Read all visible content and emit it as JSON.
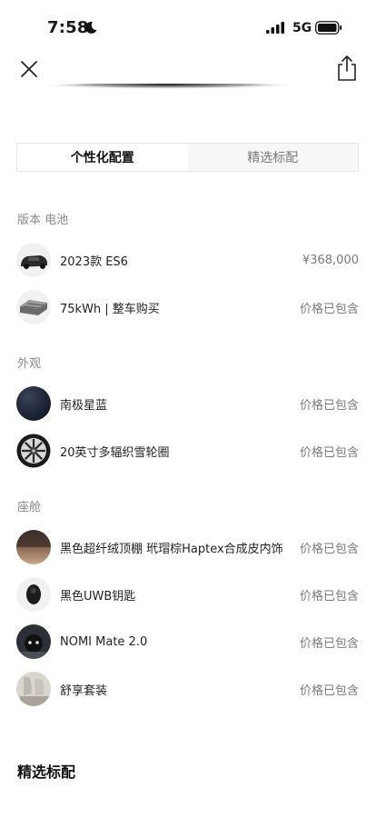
{
  "status_bar": {
    "time": "7:58",
    "network": "5G"
  },
  "tabs": [
    {
      "label": "个性化配置",
      "active": true
    },
    {
      "label": "精选标配",
      "active": false
    }
  ],
  "sections": [
    {
      "title": "版本 电池",
      "items": [
        {
          "label": "2023款 ES6",
          "price": "¥368,000",
          "icon": "car-thumbnail"
        },
        {
          "label": "75kWh | 整车购买",
          "price": "价格已包含",
          "icon": "battery-pack-thumbnail"
        }
      ]
    },
    {
      "title": "外观",
      "items": [
        {
          "label": "南极星蓝",
          "price": "价格已包含",
          "icon": "paint-color-swatch",
          "color": "#1b2233"
        },
        {
          "label": "20英寸多辐织雪轮圈",
          "price": "价格已包含",
          "icon": "wheel-thumbnail"
        }
      ]
    },
    {
      "title": "座舱",
      "items": [
        {
          "label": "黑色超纤绒顶棚 玳瑁棕Haptex合成皮内饰",
          "price": "价格已包含",
          "icon": "interior-thumbnail"
        },
        {
          "label": "黑色UWB钥匙",
          "price": "价格已包含",
          "icon": "key-fob-thumbnail"
        },
        {
          "label": "NOMI Mate 2.0",
          "price": "价格已包含",
          "icon": "nomi-thumbnail"
        },
        {
          "label": "舒享套装",
          "price": "价格已包含",
          "icon": "seat-thumbnail"
        }
      ]
    }
  ],
  "bottom_title": "精选标配"
}
